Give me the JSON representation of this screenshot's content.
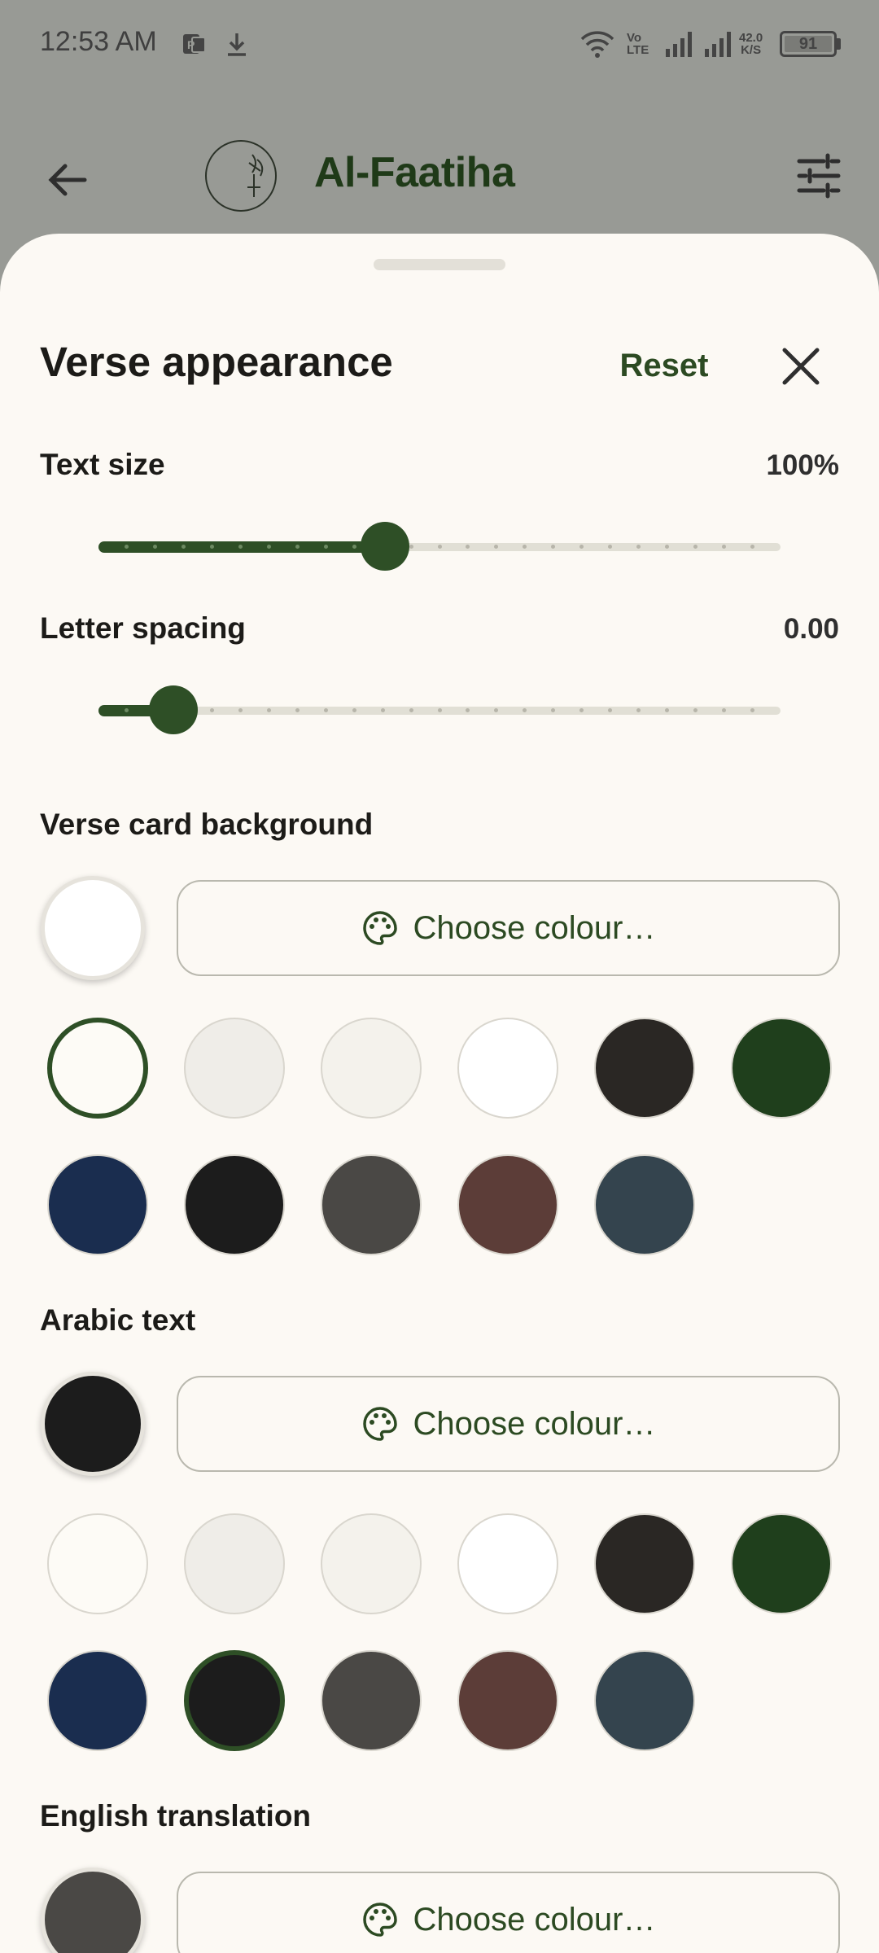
{
  "status_bar": {
    "time": "12:53 AM",
    "network_speed_top": "42.0",
    "network_speed_bottom": "K/S",
    "volte_top": "Vo",
    "volte_bottom": "LTE",
    "battery": "91"
  },
  "app_bar": {
    "title": "Al-Faatiha"
  },
  "sheet": {
    "title": "Verse appearance",
    "reset_label": "Reset",
    "text_size": {
      "label": "Text size",
      "value": "100%",
      "fraction": 0.42
    },
    "letter_spacing": {
      "label": "Letter spacing",
      "value": "0.00",
      "fraction": 0.11
    },
    "sections": [
      {
        "key": "card-bg",
        "label": "Verse card background",
        "preview_color": "#ffffff",
        "choose_label": "Choose colour…",
        "selected_index": 0
      },
      {
        "key": "arabic",
        "label": "Arabic text",
        "preview_color": "#1c1c1c",
        "choose_label": "Choose colour…",
        "selected_index": 7
      },
      {
        "key": "english",
        "label": "English translation",
        "preview_color": "#4a4845",
        "choose_label": "Choose colour…",
        "selected_index": -1
      }
    ],
    "swatch_colors": [
      "#fdfbf6",
      "#efede8",
      "#f4f2ec",
      "#ffffff",
      "#2a2724",
      "#1f3f1c",
      "#1a2d4f",
      "#1c1c1c",
      "#4a4845",
      "#5c3d38",
      "#34444e"
    ]
  },
  "colors": {
    "accent": "#2e4f26",
    "sheet_bg": "#fcf9f4",
    "scrim": "#989a95"
  }
}
